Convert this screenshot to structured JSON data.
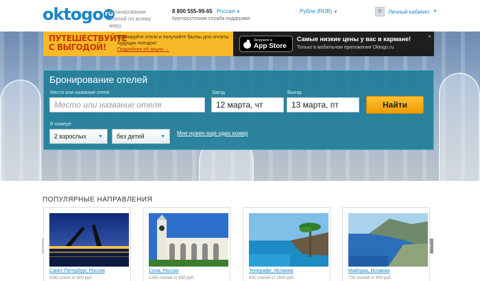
{
  "header": {
    "logo_main": "oktogo",
    "logo_ru": "ru",
    "tagline": "Бронирование отелей по всему миру",
    "phone": "8 800 555-99-65",
    "region": "Россия",
    "support": "Круглосуточная служба поддержки",
    "currency": "Рубли (RUB)",
    "cabinet": "Личный кабинет"
  },
  "promo": {
    "title": "Путешествуйте с выгодой!",
    "text": "Бронируйте отели и получайте баллы для оплаты будущих поездок!",
    "link": "Подробнее об акции →",
    "appstore_small": "Загрузите в",
    "appstore_big": "App Store",
    "app_title": "Самые низкие цены у вас в кармане!",
    "app_sub": "Только в мобильном приложении Oktogo.ru",
    "close": "×"
  },
  "search": {
    "title": "Бронирование отелей",
    "place_label": "Место или название отеля",
    "place_placeholder": "Место или название отеля",
    "checkin_label": "Заезд",
    "checkin_value": "12 марта, чт",
    "checkout_label": "Выезд",
    "checkout_value": "13 марта, пт",
    "find_button": "Найти",
    "rooms_label": "В номере",
    "adults_value": "2 взрослых",
    "children_value": "без детей",
    "extra_room": "Мне нужен еще один номер"
  },
  "popular": {
    "title": "ПОПУЛЯРНЫЕ НАПРАВЛЕНИЯ",
    "cards": [
      {
        "name": "Санкт-Петербург, Россия",
        "stat": "2082 отеля от 600 руб."
      },
      {
        "name": "Сочи, Россия",
        "stat": "1265 отелей от 830 руб."
      },
      {
        "name": "Тенерифе, Испания",
        "stat": "835 отелей от 1500 руб."
      },
      {
        "name": "Майорка, Испания",
        "stat": "739 отелей от 900 руб."
      }
    ],
    "prev": "‹",
    "next": "›"
  },
  "colors": {
    "brand": "#1a86c8",
    "accent": "#f7b928",
    "panel": "#1f7d98"
  }
}
